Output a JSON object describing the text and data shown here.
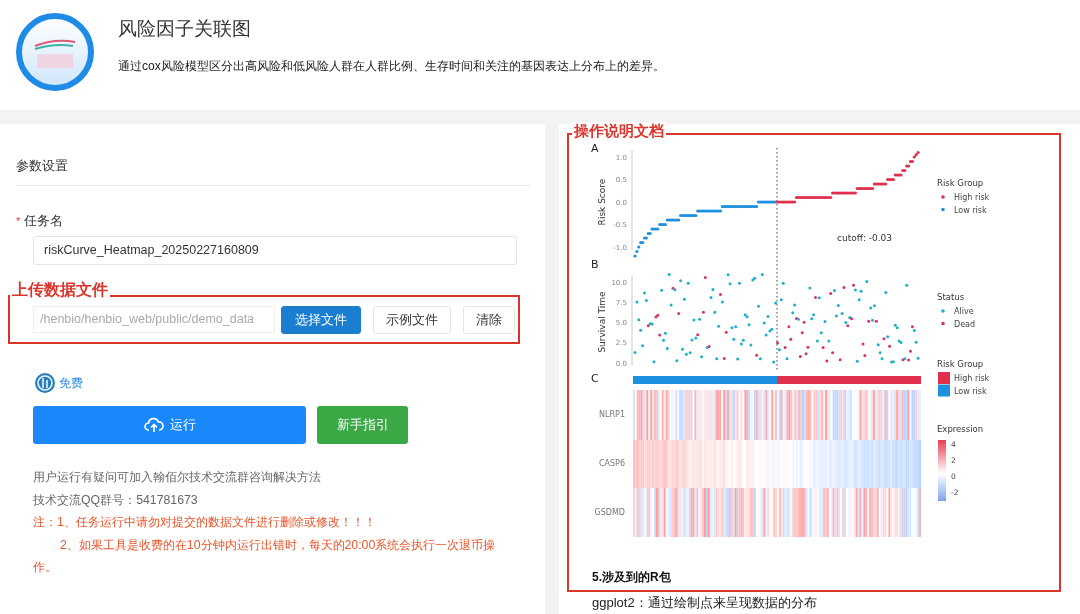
{
  "app": {
    "title": "风险因子关联图",
    "description": "通过cox风险模型区分出高风险和低风险人群在人群比例、生存时间和关注的基因表达上分布上的差异。"
  },
  "form": {
    "section_title": "参数设置",
    "task_label": {
      "text": "任务名",
      "required_mark": "*"
    },
    "task_value": "riskCurve_Heatmap_20250227160809",
    "file_path": "/henbio/henbio_web/public/demo_data",
    "file_buttons": [
      {
        "label": "选择文件",
        "kind": "primary"
      },
      {
        "label": "示例文件",
        "kind": "default"
      },
      {
        "label": "清除",
        "kind": "default"
      }
    ],
    "price": "免费",
    "run_button": "运行",
    "guide_button": "新手指引",
    "help_lines": [
      "用户运行有疑问可加入翰佰尔技术交流群咨询解决方法",
      "技术交流QQ群号：541781673"
    ],
    "notes": [
      "注：1、任务运行中请勿对提交的数据文件进行删除或修改！！！",
      "2、如果工具是收费的在10分钟内运行出错时，每天的20:00系统会执行一次退币操作。"
    ]
  },
  "annotations": [
    {
      "label": "上传数据文件"
    },
    {
      "label": "操作说明文档"
    }
  ],
  "document": {
    "figure": {
      "panels": [
        {
          "letter": "A",
          "y_title": "Risk Score",
          "y_ticks": [
            "1.0",
            "0.5",
            "0.0",
            "-0.5",
            "-1.0"
          ]
        },
        {
          "letter": "B",
          "y_title": "Survival Time",
          "y_ticks": [
            "10.0",
            "7.5",
            "5.0",
            "2.5",
            "0.0"
          ]
        },
        {
          "letter": "C"
        }
      ],
      "cutoff_label": "cutoff: -0.03",
      "legends": [
        {
          "title": "Risk Group",
          "kind": "dots",
          "items": [
            {
              "label": "High risk",
              "color": "#e0304e"
            },
            {
              "label": "Low risk",
              "color": "#1e90e0"
            }
          ]
        },
        {
          "title": "Status",
          "kind": "dots",
          "items": [
            {
              "label": "Alive",
              "color": "#20b0c8"
            },
            {
              "label": "Dead",
              "color": "#d8336a"
            }
          ]
        },
        {
          "title": "Risk Group",
          "kind": "swatches",
          "items": [
            {
              "label": "High risk",
              "color": "#e0304e"
            },
            {
              "label": "Low risk",
              "color": "#1e90e0"
            }
          ]
        },
        {
          "title": "Expression",
          "kind": "gradient",
          "ticks": [
            "4",
            "2",
            "0",
            "-2"
          ]
        }
      ],
      "genes": [
        "NLRP1",
        "CASP6",
        "GSDMD"
      ]
    },
    "section_heading": "5.涉及到的R包",
    "package_line": "ggplot2：通过绘制点来呈现数据的分布"
  }
}
